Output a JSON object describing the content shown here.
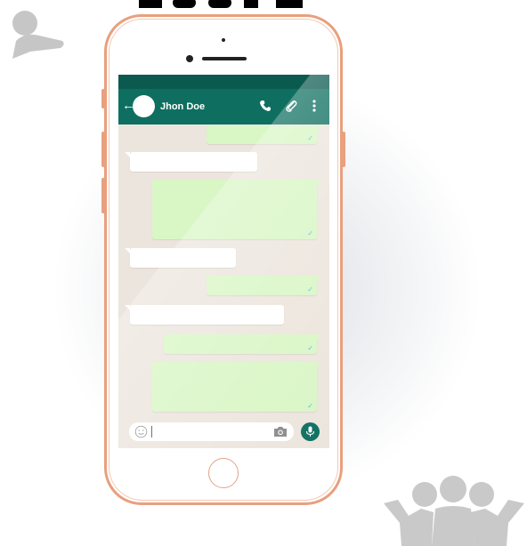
{
  "chat": {
    "contact_name": "Jhon Doe",
    "messages": [
      {
        "direction": "out",
        "tick": "✓"
      },
      {
        "direction": "in"
      },
      {
        "direction": "out",
        "tick": "✓"
      },
      {
        "direction": "in"
      },
      {
        "direction": "out",
        "tick": "✓"
      },
      {
        "direction": "in"
      },
      {
        "direction": "out",
        "tick": "✓"
      },
      {
        "direction": "out",
        "tick": "✓"
      }
    ]
  },
  "icons": {
    "back": "←",
    "call": "phone-icon",
    "attach": "paperclip-icon",
    "menu": "more-vertical-icon",
    "emoji": "emoji-icon",
    "camera": "camera-icon",
    "mic": "microphone-icon"
  },
  "colors": {
    "header": "#0e6f60",
    "status_bar": "#0b5a4f",
    "chat_background": "#ece5dd",
    "outgoing_bubble": "#d9f6c5",
    "incoming_bubble": "#ffffff",
    "phone_frame": "#e8a07e",
    "read_tick": "#4fb6ec"
  }
}
